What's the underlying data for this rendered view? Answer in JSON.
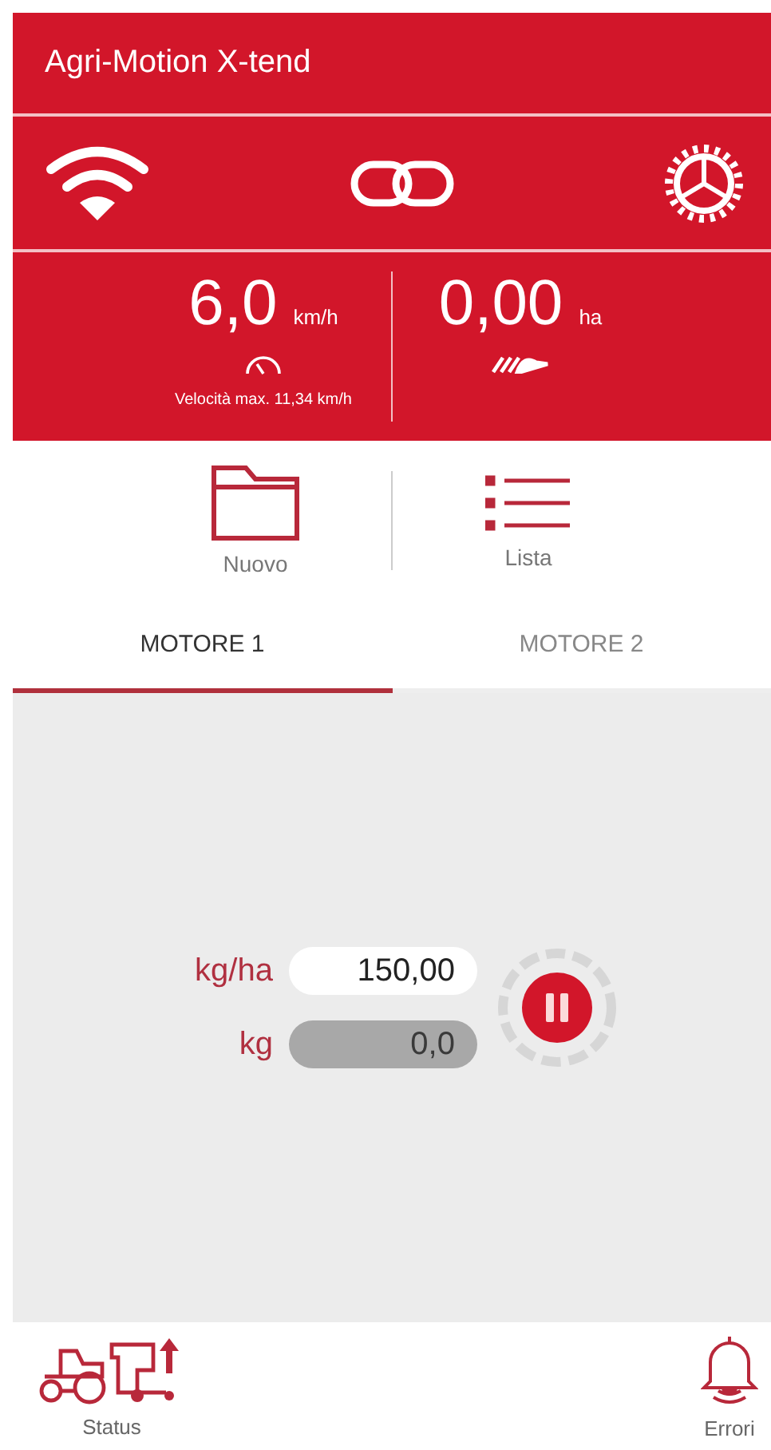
{
  "header": {
    "title": "Agri-Motion X-tend"
  },
  "stats": [
    {
      "value": "6,0",
      "unit": "km/h",
      "kind": "speed",
      "note": "Velocità max. 11,34 km/h"
    },
    {
      "value": "0,00",
      "unit": "ha",
      "kind": "area"
    }
  ],
  "actions": [
    {
      "label": "Nuovo",
      "kind": "folder"
    },
    {
      "label": "Lista",
      "kind": "list"
    }
  ],
  "tabs": [
    {
      "label": "MOTORE 1",
      "selected": true
    },
    {
      "label": "MOTORE 2",
      "selected": false
    }
  ],
  "fields": [
    {
      "label": "kg/ha",
      "value": "150,00",
      "disabled": false
    },
    {
      "label": "kg",
      "value": "0,0",
      "disabled": true
    }
  ],
  "bottom_nav": [
    {
      "label": "Status",
      "kind": "status"
    },
    {
      "label": "Errori",
      "kind": "alarm"
    }
  ]
}
